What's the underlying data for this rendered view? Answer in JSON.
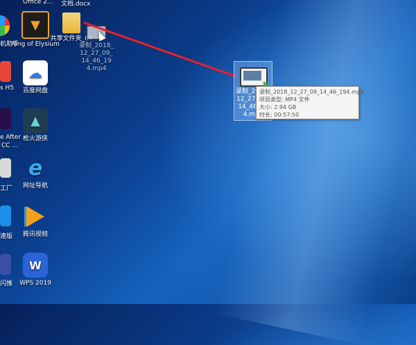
{
  "desktop": {
    "cutoff_labels": {
      "top_center": "Office 2...",
      "top_doc": "文档.docx",
      "left_1": "机助手",
      "left_2": "s H5",
      "left_3": "e After",
      "left_3b": "CC ...",
      "left_4": "工厂",
      "left_5": "速版",
      "left_6": "闪推"
    },
    "icons": [
      {
        "label": "Ring of Elysium",
        "icon": "ring-of-elysium-icon",
        "color": "#1d1d1d"
      },
      {
        "label": "百度网盘",
        "icon": "baidu-netdisk-icon",
        "color": "#ffffff"
      },
      {
        "label": "枪火游侠",
        "icon": "gunfire-ranger-icon",
        "color": "#1f3d52"
      },
      {
        "label": "网址导航",
        "icon": "ie-browser-icon",
        "color": "#1e7bd9"
      },
      {
        "label": "腾讯视频",
        "icon": "tencent-video-icon",
        "color": "#29a0e0"
      },
      {
        "label": "WPS 2019",
        "icon": "wps-icon",
        "color": "#2a64d6"
      },
      {
        "label": "共享文件夹_01",
        "icon": "folder-icon",
        "color": "#f3c552"
      },
      {
        "label": "录制_2018_12_27_09_14_46_194.mp4",
        "icon": "video-file-icon",
        "color": "#2f3a45"
      }
    ],
    "selected_file": {
      "label": "录制_2018_12_27_09_14_46_194.mp4",
      "label_visible": "录制_2018_12_27_09_14_46_194.mp4"
    },
    "tooltip": {
      "name": "录制_2018_12_27_09_14_46_194.mp4",
      "type": "项目类型: MP4 文件",
      "size": "大小: 2.94 GB",
      "duration": "时长: 00:57:50"
    },
    "annotation_color": "#e8202a"
  }
}
